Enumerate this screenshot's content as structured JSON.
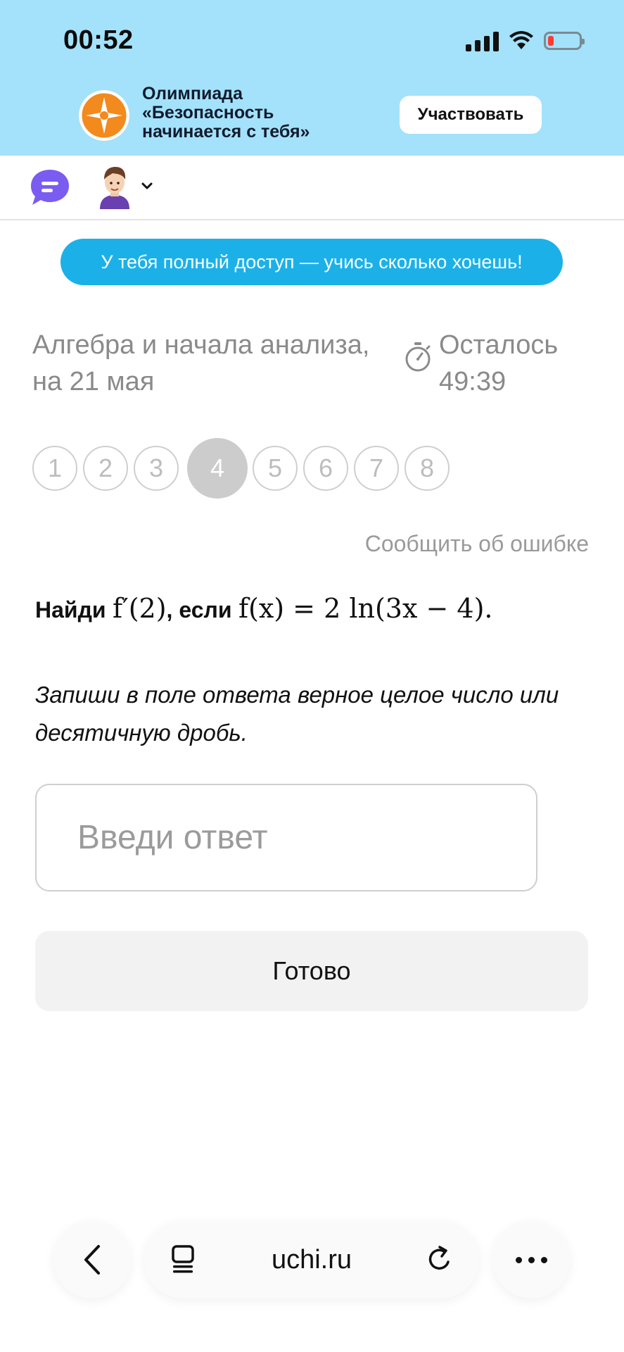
{
  "status_bar": {
    "time": "00:52"
  },
  "promo": {
    "title_lines": [
      "Олимпиада",
      "«Безопасность",
      "начинается с тебя»"
    ],
    "button_label": "Участвовать"
  },
  "access_banner": "У тебя полный доступ — учись сколько хочешь!",
  "assignment": {
    "subject_line1": "Алгебра и начала анализа,",
    "subject_line2": "на 21 мая",
    "timer_line1": "Осталось",
    "timer_line2": "49:39"
  },
  "pager": {
    "questions": [
      "1",
      "2",
      "3",
      "4",
      "5",
      "6",
      "7",
      "8"
    ],
    "active": "4"
  },
  "report_link": "Сообщить об ошибке",
  "task": {
    "find_word": "Найди",
    "target": "f′(2)",
    "if_word": ", если",
    "function": "f(x) = 2 ln(3x − 4)."
  },
  "hint": "Запиши в поле ответа верное целое число или десятичную дробь.",
  "answer": {
    "placeholder": "Введи ответ",
    "value": ""
  },
  "done_button": "Готово",
  "browser": {
    "url": "uchi.ru"
  },
  "icons": {
    "chat": "chat-bubble-icon",
    "avatar": "user-avatar",
    "timer": "stopwatch-icon",
    "back": "chevron-left-icon",
    "tabs": "tabs-icon",
    "reload": "reload-icon",
    "more": "more-dots-icon"
  },
  "colors": {
    "banner_bg": "#a3e2fa",
    "access_pill": "#1bb1e8",
    "chat_icon": "#7b5cf0",
    "logo": "#f28a1e"
  }
}
